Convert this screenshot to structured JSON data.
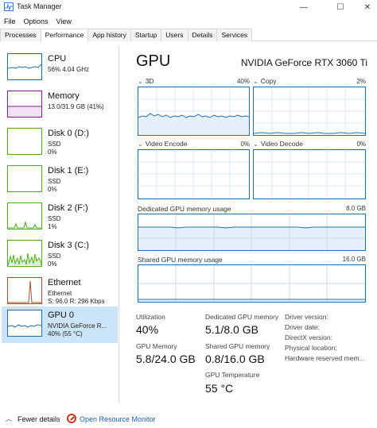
{
  "window": {
    "title": "Task Manager",
    "min_glyph": "—",
    "max_glyph": "☐",
    "close_glyph": "✕"
  },
  "menu": [
    "File",
    "Options",
    "View"
  ],
  "tabs": [
    {
      "label": "Processes",
      "active": false
    },
    {
      "label": "Performance",
      "active": true
    },
    {
      "label": "App history",
      "active": false
    },
    {
      "label": "Startup",
      "active": false
    },
    {
      "label": "Users",
      "active": false
    },
    {
      "label": "Details",
      "active": false
    },
    {
      "label": "Services",
      "active": false
    }
  ],
  "sidebar": {
    "items": [
      {
        "title": "CPU",
        "line1": "56% 4.04 GHz",
        "line2": "",
        "color": "#1e6fb8",
        "selected": false
      },
      {
        "title": "Memory",
        "line1": "13.0/31.9 GB (41%)",
        "line2": "",
        "color": "#8b1a9b",
        "selected": false
      },
      {
        "title": "Disk 0 (D:)",
        "line1": "SSD",
        "line2": "0%",
        "color": "#4caf1a",
        "selected": false
      },
      {
        "title": "Disk 1 (E:)",
        "line1": "SSD",
        "line2": "0%",
        "color": "#4caf1a",
        "selected": false
      },
      {
        "title": "Disk 2 (F:)",
        "line1": "SSD",
        "line2": "1%",
        "color": "#4caf1a",
        "selected": false
      },
      {
        "title": "Disk 3 (C:)",
        "line1": "SSD",
        "line2": "0%",
        "color": "#4caf1a",
        "selected": false
      },
      {
        "title": "Ethernet",
        "line1": "Ethernet",
        "line2": "S: 96.0  R: 296 Kbps",
        "color": "#a0522d",
        "selected": false
      },
      {
        "title": "GPU 0",
        "line1": "NVIDIA GeForce R...",
        "line2": "40% (55 °C)",
        "color": "#1e6fb8",
        "selected": true
      }
    ]
  },
  "main": {
    "title": "GPU",
    "gpu_name": "NVIDIA GeForce RTX 3060 Ti",
    "engines": [
      {
        "label": "3D",
        "pct": "40%"
      },
      {
        "label": "Copy",
        "pct": "2%"
      },
      {
        "label": "Video Encode",
        "pct": "0%"
      },
      {
        "label": "Video Decode",
        "pct": "0%"
      }
    ],
    "dedicated_label": "Dedicated GPU memory usage",
    "dedicated_max": "8.0 GB",
    "shared_label": "Shared GPU memory usage",
    "shared_max": "16.0 GB",
    "stats": {
      "utilization_label": "Utilization",
      "utilization_value": "40%",
      "dedicated_mem_label": "Dedicated GPU memory",
      "dedicated_mem_value": "5.1/8.0 GB",
      "gpu_memory_label": "GPU Memory",
      "gpu_memory_value": "5.8/24.0 GB",
      "shared_mem_label": "Shared GPU memory",
      "shared_mem_value": "0.8/16.0 GB",
      "gpu_temp_label": "GPU Temperature",
      "gpu_temp_value": "55 °C"
    },
    "info": [
      "Driver version:",
      "Driver date:",
      "DirectX version:",
      "Physical location:",
      "Hardware reserved mem..."
    ]
  },
  "footer": {
    "fewer_details": "Fewer details",
    "open_resource_monitor": "Open Resource Monitor"
  },
  "colors": {
    "accent": "#1e6fb8",
    "selected_bg": "#cce4f7",
    "link": "#1a5fb4"
  }
}
